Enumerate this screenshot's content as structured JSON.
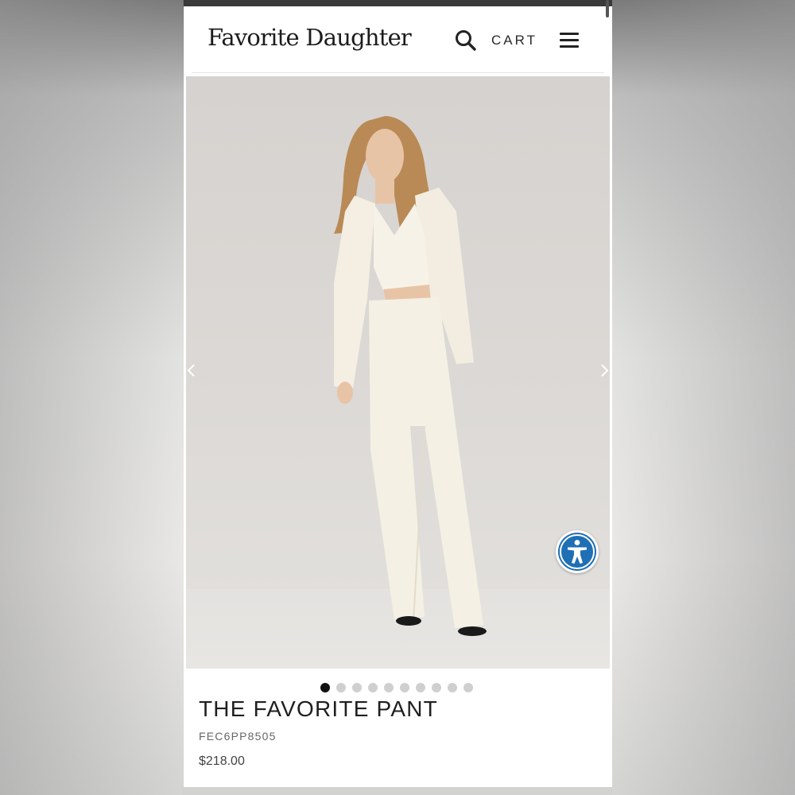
{
  "header": {
    "logo": "Favorite Daughter",
    "cart_label": "CART",
    "icons": {
      "search": "search-icon",
      "menu": "hamburger-menu-icon"
    }
  },
  "gallery": {
    "image_alt": "Model wearing white blazer, white vest and wide-leg white pants",
    "slide_count": 10,
    "active_index": 0,
    "icons": {
      "prev": "chevron-left-icon",
      "next": "chevron-right-icon"
    }
  },
  "accessibility": {
    "icon": "accessibility-icon",
    "color": "#1f6fb5"
  },
  "product": {
    "title": "THE FAVORITE PANT",
    "sku": "FEC6PP8505",
    "price": "$218.00"
  }
}
